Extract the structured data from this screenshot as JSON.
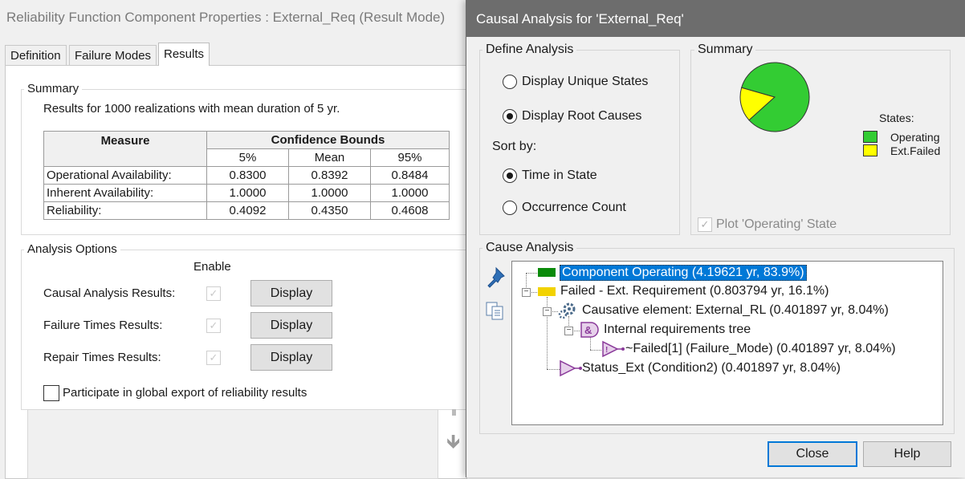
{
  "back_window": {
    "title": "Reliability Function Component Properties : External_Req (Result Mode)",
    "tabs": [
      "Definition",
      "Failure Modes",
      "Results"
    ],
    "summary": {
      "legend": "Summary",
      "results_text": "Results for 1000 realizations with mean duration of 5 yr.",
      "table_headers": {
        "measure": "Measure",
        "bounds": "Confidence Bounds"
      },
      "sub_headers": [
        "5%",
        "Mean",
        "95%"
      ],
      "rows": [
        {
          "label": "Operational Availability:",
          "values": [
            "0.8300",
            "0.8392",
            "0.8484"
          ]
        },
        {
          "label": "Inherent Availability:",
          "values": [
            "1.0000",
            "1.0000",
            "1.0000"
          ]
        },
        {
          "label": "Reliability:",
          "values": [
            "0.4092",
            "0.4350",
            "0.4608"
          ]
        }
      ]
    },
    "analysis_options": {
      "legend": "Analysis Options",
      "enable_label": "Enable",
      "rows": [
        {
          "label": "Causal Analysis Results:",
          "button": "Display"
        },
        {
          "label": "Failure Times Results:",
          "button": "Display"
        },
        {
          "label": "Repair Times Results:",
          "button": "Display"
        }
      ],
      "export_label": "Participate in global export of reliability results"
    }
  },
  "dialog": {
    "title": "Causal Analysis for 'External_Req'",
    "define": {
      "legend": "Define Analysis",
      "unique_states": "Display Unique States",
      "root_causes": "Display Root Causes",
      "sort_by": "Sort by:",
      "time_in_state": "Time in State",
      "occurrence_count": "Occurrence Count"
    },
    "summary": {
      "legend": "Summary",
      "states_label": "States:",
      "legend_items": [
        {
          "label": "Operating",
          "color": "#33cc33"
        },
        {
          "label": "Ext.Failed",
          "color": "#ffff00"
        }
      ],
      "plot_operating": "Plot 'Operating' State"
    },
    "cause": {
      "legend": "Cause Analysis",
      "items": [
        "Component Operating (4.19621 yr, 83.9%)",
        "Failed - Ext. Requirement (0.803794 yr, 16.1%)",
        "Causative element: External_RL (0.401897 yr, 8.04%)",
        "Internal requirements tree",
        "~Failed[1]  (Failure_Mode) (0.401897 yr, 8.04%)",
        "Status_Ext  (Condition2) (0.401897 yr, 8.04%)"
      ]
    },
    "buttons": {
      "close": "Close",
      "help": "Help"
    }
  },
  "chart_data": {
    "type": "pie",
    "categories": [
      "Operating",
      "Ext.Failed"
    ],
    "values": [
      83.9,
      16.1
    ],
    "title": "",
    "legend_title": "States:",
    "legend_position": "right"
  }
}
